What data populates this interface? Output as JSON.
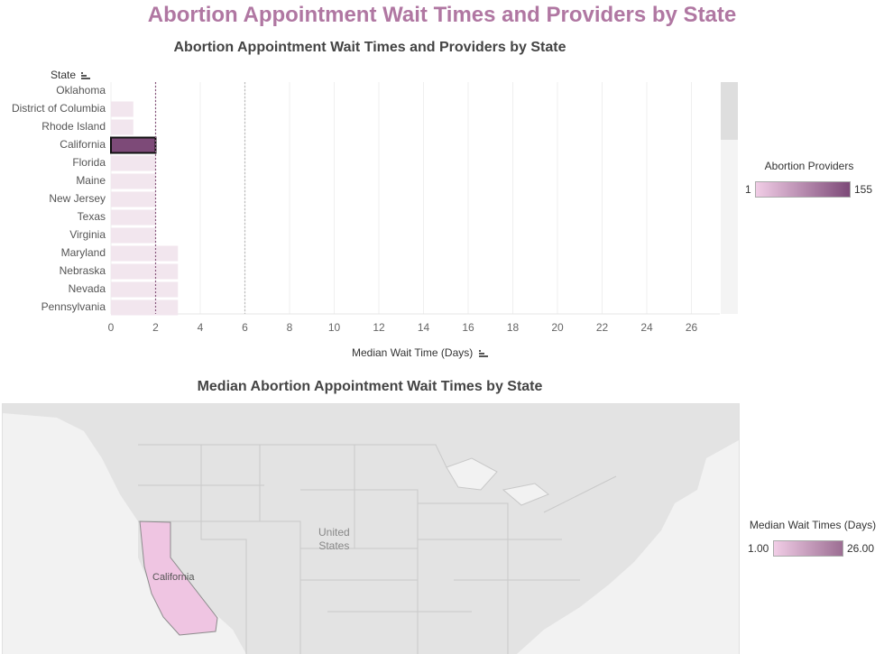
{
  "page_title": "Abortion Appointment Wait Times and Providers by State",
  "chart_data": {
    "type": "bar",
    "orientation": "horizontal",
    "title": "Abortion Appointment Wait Times and Providers by State",
    "ylabel": "State",
    "xlabel": "Median Wait Time (Days)",
    "categories": [
      "Oklahoma",
      "District of Columbia",
      "Rhode Island",
      "California",
      "Florida",
      "Maine",
      "New Jersey",
      "Texas",
      "Virginia",
      "Maryland",
      "Nebraska",
      "Nevada",
      "Pennsylvania"
    ],
    "values": [
      0,
      1,
      1,
      2,
      2,
      2,
      2,
      2,
      2,
      3,
      3,
      3,
      3
    ],
    "selected": "California",
    "xlim": [
      0,
      27.2
    ],
    "xticks": [
      0,
      2,
      4,
      6,
      8,
      10,
      12,
      14,
      16,
      18,
      20,
      22,
      24,
      26
    ],
    "reference_lines": [
      2,
      6
    ],
    "grid": true,
    "colors": {
      "bar": "#f2e6ee",
      "selected": "#7d4a78",
      "reference": "#8a5a80"
    }
  },
  "providers_legend": {
    "title": "Abortion Providers",
    "min": "1",
    "max": "155",
    "from": "#f1cde6",
    "to": "#7d4a78"
  },
  "map": {
    "title": "Median Abortion Appointment Wait Times by State",
    "country_label": "United\nStates",
    "state_label": "California",
    "highlight_color": "#efc5e2"
  },
  "wait_legend": {
    "title": "Median Wait Times (Days)",
    "min": "1.00",
    "max": "26.00",
    "from": "#f1cde6",
    "to": "#9c6e93"
  }
}
